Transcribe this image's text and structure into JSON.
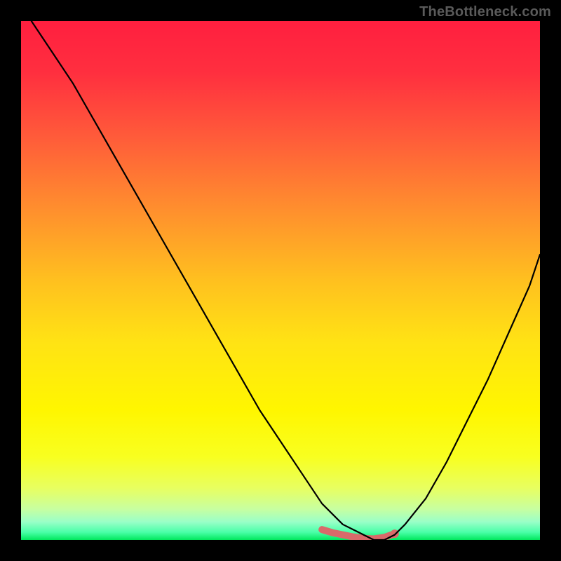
{
  "credit": "TheBottleneck.com",
  "gradient_stops": [
    {
      "offset": 0.0,
      "color": "#ff1f3f"
    },
    {
      "offset": 0.1,
      "color": "#ff2f3f"
    },
    {
      "offset": 0.22,
      "color": "#ff5a3a"
    },
    {
      "offset": 0.35,
      "color": "#ff8a2f"
    },
    {
      "offset": 0.5,
      "color": "#ffc01f"
    },
    {
      "offset": 0.62,
      "color": "#ffe314"
    },
    {
      "offset": 0.75,
      "color": "#fff600"
    },
    {
      "offset": 0.84,
      "color": "#f8ff20"
    },
    {
      "offset": 0.9,
      "color": "#e8ff60"
    },
    {
      "offset": 0.94,
      "color": "#c8ffa0"
    },
    {
      "offset": 0.965,
      "color": "#9affc8"
    },
    {
      "offset": 0.985,
      "color": "#4affa8"
    },
    {
      "offset": 1.0,
      "color": "#00e85d"
    }
  ],
  "curve_color": "#000000",
  "curve_width": 2.2,
  "highlight_color": "#d96a6a",
  "highlight_width": 10,
  "chart_data": {
    "type": "line",
    "title": "",
    "xlabel": "",
    "ylabel": "",
    "xlim": [
      0,
      100
    ],
    "ylim": [
      0,
      100
    ],
    "grid": false,
    "legend": false,
    "note": "V-shaped bottleneck-mismatch curve: left branch starts very high, drops to ~0 near x≈68, flat trough x≈58–72 (highlighted pink), then right branch rises toward ~55 at x=100. Y values are estimated as percentage of vertical span (0 = bottom / green, 100 = top / red).",
    "series": [
      {
        "name": "bottleneck-percentage",
        "x": [
          2,
          6,
          10,
          14,
          18,
          22,
          26,
          30,
          34,
          38,
          42,
          46,
          50,
          54,
          58,
          62,
          66,
          68,
          70,
          72,
          74,
          78,
          82,
          86,
          90,
          94,
          98,
          100
        ],
        "values": [
          100,
          94,
          88,
          81,
          74,
          67,
          60,
          53,
          46,
          39,
          32,
          25,
          19,
          13,
          7,
          3,
          1,
          0,
          0,
          1,
          3,
          8,
          15,
          23,
          31,
          40,
          49,
          55
        ]
      },
      {
        "name": "optimal-range-highlight",
        "x": [
          58,
          60,
          62,
          64,
          66,
          68,
          70,
          72
        ],
        "values": [
          2,
          1.4,
          1,
          0.6,
          0.3,
          0.2,
          0.5,
          1.2
        ]
      }
    ]
  }
}
